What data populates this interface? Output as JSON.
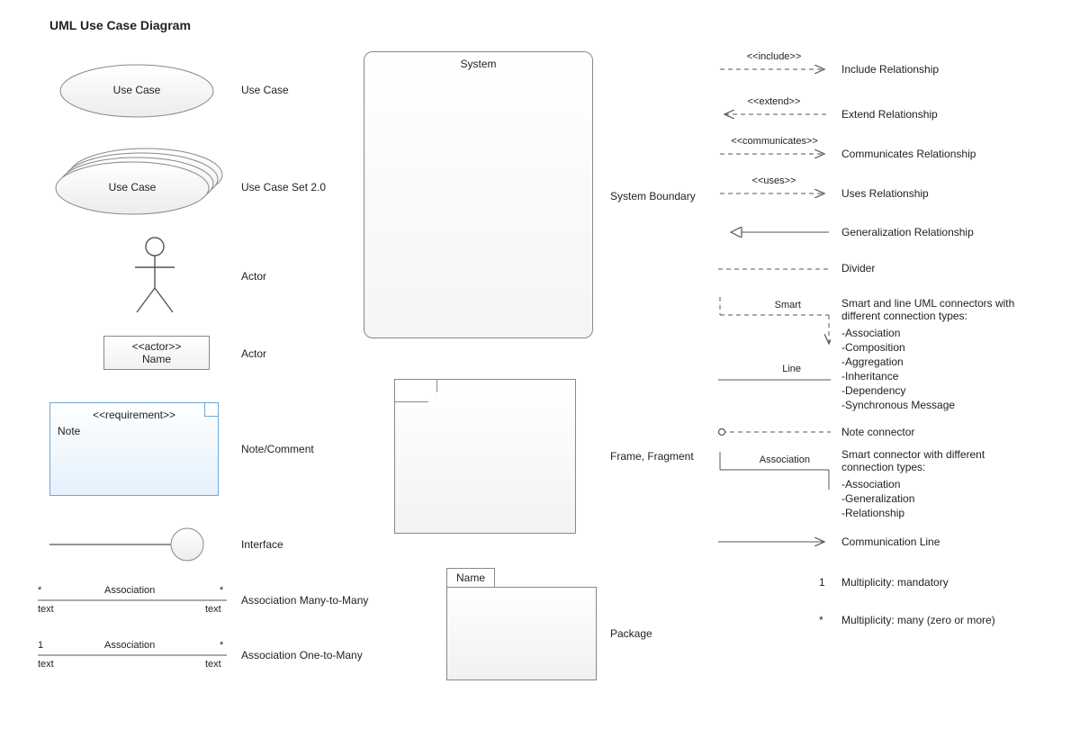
{
  "title": "UML Use Case Diagram",
  "left_col": {
    "use_case_label": "Use Case",
    "use_case_text": "Use Case",
    "use_case_set_label": "Use Case Set 2.0",
    "use_case_set_text": "Use Case",
    "actor_label": "Actor",
    "actor_box_stereotype": "<<actor>>",
    "actor_box_name": "Name",
    "actor_box_label": "Actor",
    "note_stereotype": "<<requirement>>",
    "note_text": "Note",
    "note_label": "Note/Comment",
    "interface_label": "Interface",
    "assoc_mm_word": "Association",
    "assoc_mm_left_mult": "*",
    "assoc_mm_right_mult": "*",
    "assoc_mm_left_role": "text",
    "assoc_mm_right_role": "text",
    "assoc_mm_label": "Association Many-to-Many",
    "assoc_om_word": "Association",
    "assoc_om_left_mult": "1",
    "assoc_om_right_mult": "*",
    "assoc_om_left_role": "text",
    "assoc_om_right_role": "text",
    "assoc_om_label": "Association One-to-Many"
  },
  "center_col": {
    "system_title": "System",
    "system_boundary_label": "System Boundary",
    "frame_label": "Frame, Fragment",
    "package_name": "Name",
    "package_label": "Package"
  },
  "right_col": {
    "include": {
      "stereo": "<<include>>",
      "label": "Include Relationship"
    },
    "extend": {
      "stereo": "<<extend>>",
      "label": "Extend Relationship"
    },
    "communicates": {
      "stereo": "<<communicates>>",
      "label": "Communicates Relationship"
    },
    "uses": {
      "stereo": "<<uses>>",
      "label": "Uses Relationship"
    },
    "generalization": {
      "label": "Generalization Relationship"
    },
    "divider": {
      "label": "Divider"
    },
    "smart": {
      "smart_word": "Smart",
      "line_word": "Line",
      "label": "Smart and line UML connectors with different connection types:",
      "types": "-Association\n-Composition\n-Aggregation\n-Inheritance\n-Dependency\n-Synchronous Message"
    },
    "note_conn": {
      "label": "Note connector"
    },
    "association_smart": {
      "assoc_word": "Association",
      "label": "Smart connector with different connection types:",
      "types": "-Association\n-Generalization\n-Relationship"
    },
    "comm_line": {
      "label": "Communication Line"
    },
    "mult_one": {
      "sym": "1",
      "label": "Multiplicity: mandatory"
    },
    "mult_many": {
      "sym": "*",
      "label": "Multiplicity: many (zero or more)"
    }
  }
}
